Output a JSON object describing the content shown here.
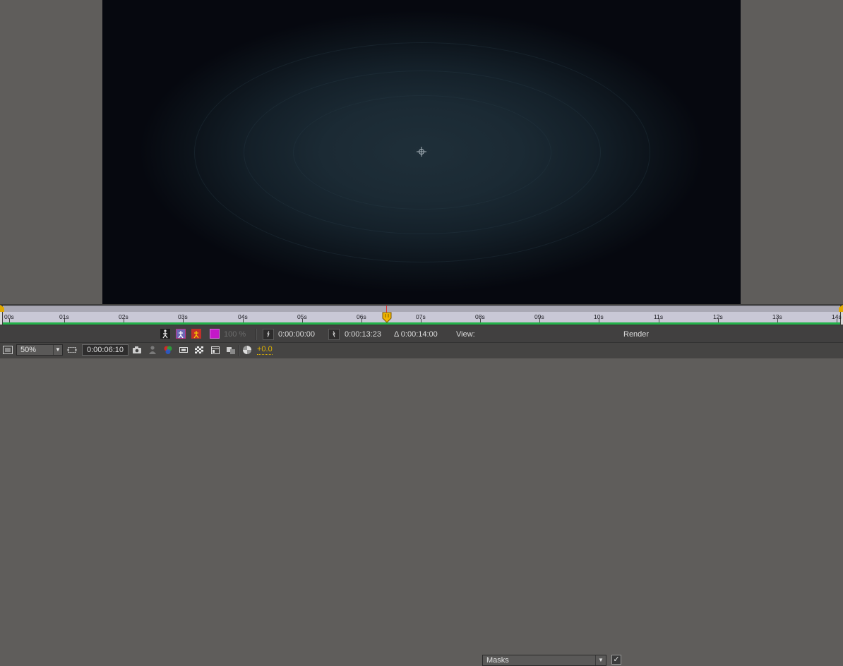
{
  "timeline": {
    "ticks": [
      "00s",
      "01s",
      "02s",
      "03s",
      "04s",
      "05s",
      "06s",
      "07s",
      "08s",
      "09s",
      "10s",
      "11s",
      "12s",
      "13s",
      "14s"
    ],
    "current_time_value": "0:00:06:10"
  },
  "controls": {
    "percent_label": "100 %",
    "start_time": "0:00:00:00",
    "end_time": "0:00:13:23",
    "duration": "Δ 0:00:14:00",
    "view_label": "View:",
    "view_value": "Masks",
    "render_label": "Render",
    "render_checked": true,
    "render_check_glyph": "✓"
  },
  "bottom": {
    "zoom_value": "50%",
    "current_time": "0:00:06:10",
    "exposure": "+0.0"
  },
  "colors": {
    "accent_yellow": "#e0b400",
    "timeline_green": "#23b24a",
    "playhead_red": "#dd3333"
  },
  "icons": {
    "crosshair": "anchor-crosshair-icon",
    "playhead": "current-time-indicator-icon"
  }
}
